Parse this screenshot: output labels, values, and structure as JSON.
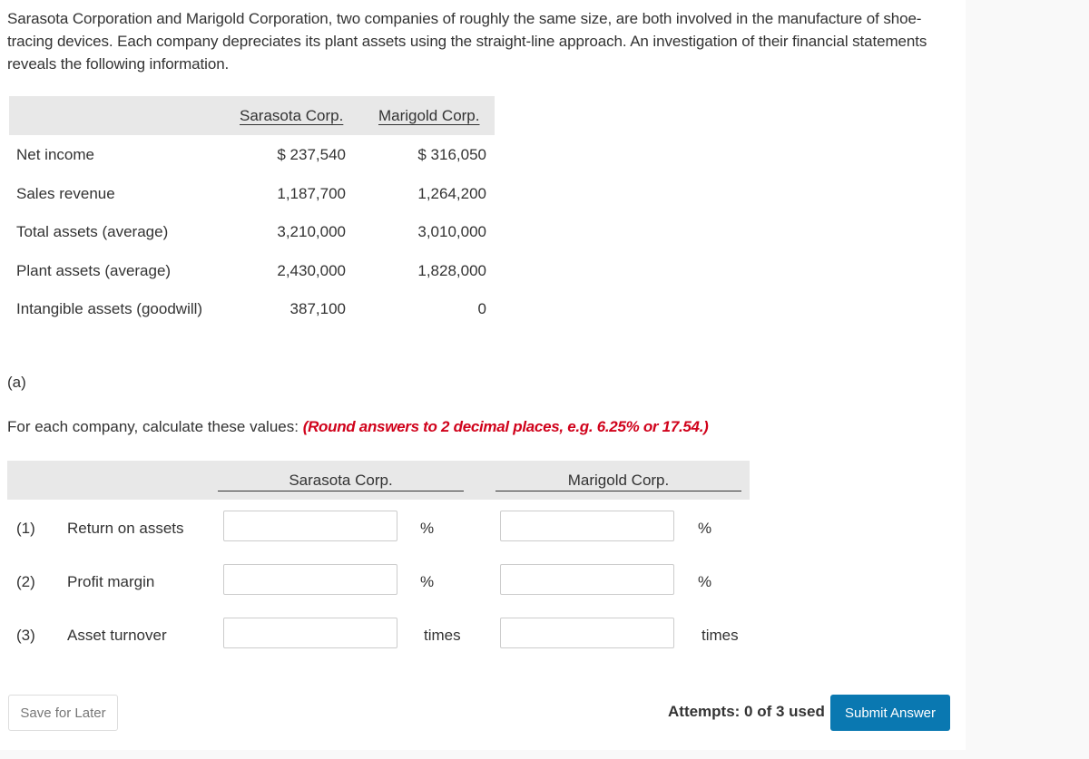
{
  "intro": "Sarasota Corporation and Marigold Corporation, two companies of roughly the same size, are both involved in the manufacture of shoe-tracing devices. Each company depreciates its plant assets using the straight-line approach. An investigation of their financial statements reveals the following information.",
  "info_table": {
    "columns": [
      "Sarasota Corp.",
      "Marigold Corp."
    ],
    "rows": [
      {
        "label": "Net income",
        "sarasota": "$ 237,540",
        "marigold": "$ 316,050"
      },
      {
        "label": "Sales revenue",
        "sarasota": "1,187,700",
        "marigold": "1,264,200"
      },
      {
        "label": "Total assets (average)",
        "sarasota": "3,210,000",
        "marigold": "3,010,000"
      },
      {
        "label": "Plant assets (average)",
        "sarasota": "2,430,000",
        "marigold": "1,828,000"
      },
      {
        "label": "Intangible assets (goodwill)",
        "sarasota": "387,100",
        "marigold": "0"
      }
    ]
  },
  "part_label": "(a)",
  "instruction": "For each company, calculate these values: ",
  "instruction_note": "(Round answers to 2 decimal places, e.g. 6.25% or 17.54.)",
  "answer_table": {
    "columns": [
      "Sarasota Corp.",
      "Marigold Corp."
    ],
    "rows": [
      {
        "num": "(1)",
        "label": "Return on assets",
        "unit": "%",
        "sarasota_value": "",
        "marigold_value": ""
      },
      {
        "num": "(2)",
        "label": "Profit margin",
        "unit": "%",
        "sarasota_value": "",
        "marigold_value": ""
      },
      {
        "num": "(3)",
        "label": "Asset turnover",
        "unit": "times",
        "sarasota_value": "",
        "marigold_value": ""
      }
    ]
  },
  "footer": {
    "save_label": "Save for Later",
    "attempts": "Attempts: 0 of 3 used",
    "submit_label": "Submit Answer"
  }
}
